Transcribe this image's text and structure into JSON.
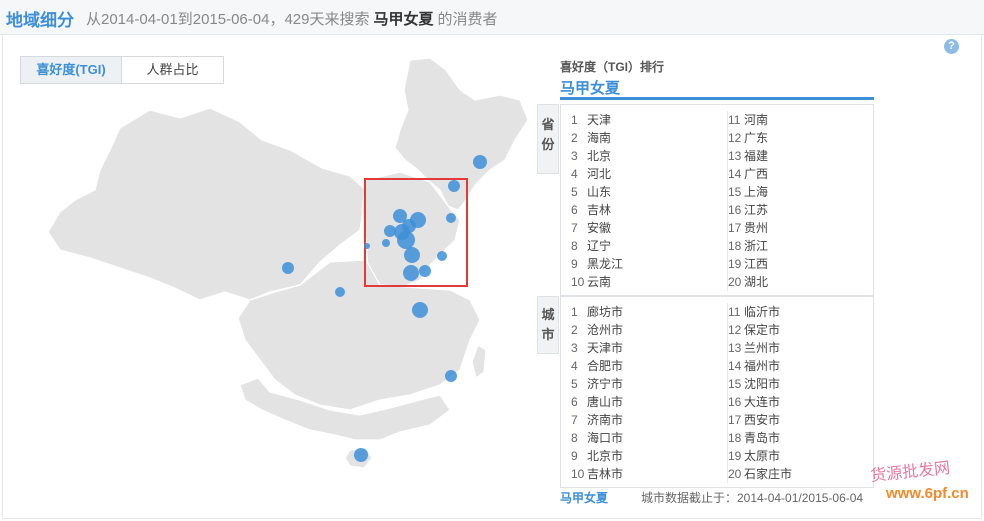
{
  "header": {
    "title": "地域细分",
    "subtitle_prefix": "从2014-04-01到2015-06-04，429天来搜索",
    "keyword": "马甲女夏",
    "subtitle_suffix": "的消费者"
  },
  "help_icon": "?",
  "toggle": {
    "tgi_label": "喜好度(TGI)",
    "share_label": "人群占比"
  },
  "ranking": {
    "title": "喜好度（TGI）排行",
    "keyword": "马甲女夏",
    "province_tab": "省份",
    "city_tab": "城市",
    "provinces_left": [
      {
        "n": "1",
        "name": "天津"
      },
      {
        "n": "2",
        "name": "海南"
      },
      {
        "n": "3",
        "name": "北京"
      },
      {
        "n": "4",
        "name": "河北"
      },
      {
        "n": "5",
        "name": "山东"
      },
      {
        "n": "6",
        "name": "吉林"
      },
      {
        "n": "7",
        "name": "安徽"
      },
      {
        "n": "8",
        "name": "辽宁"
      },
      {
        "n": "9",
        "name": "黑龙江"
      },
      {
        "n": "10",
        "name": "云南"
      }
    ],
    "provinces_right": [
      {
        "n": "11",
        "name": "河南"
      },
      {
        "n": "12",
        "name": "广东"
      },
      {
        "n": "13",
        "name": "福建"
      },
      {
        "n": "14",
        "name": "广西"
      },
      {
        "n": "15",
        "name": "上海"
      },
      {
        "n": "16",
        "name": "江苏"
      },
      {
        "n": "17",
        "name": "贵州"
      },
      {
        "n": "18",
        "name": "浙江"
      },
      {
        "n": "19",
        "name": "江西"
      },
      {
        "n": "20",
        "name": "湖北"
      }
    ],
    "cities_left": [
      {
        "n": "1",
        "name": "廊坊市"
      },
      {
        "n": "2",
        "name": "沧州市"
      },
      {
        "n": "3",
        "name": "天津市"
      },
      {
        "n": "4",
        "name": "合肥市"
      },
      {
        "n": "5",
        "name": "济宁市"
      },
      {
        "n": "6",
        "name": "唐山市"
      },
      {
        "n": "7",
        "name": "济南市"
      },
      {
        "n": "8",
        "name": "海口市"
      },
      {
        "n": "9",
        "name": "北京市"
      },
      {
        "n": "10",
        "name": "吉林市"
      }
    ],
    "cities_right": [
      {
        "n": "11",
        "name": "临沂市"
      },
      {
        "n": "12",
        "name": "保定市"
      },
      {
        "n": "13",
        "name": "兰州市"
      },
      {
        "n": "14",
        "name": "福州市"
      },
      {
        "n": "15",
        "name": "沈阳市"
      },
      {
        "n": "16",
        "name": "大连市"
      },
      {
        "n": "17",
        "name": "西安市"
      },
      {
        "n": "18",
        "name": "青岛市"
      },
      {
        "n": "19",
        "name": "太原市"
      },
      {
        "n": "20",
        "name": "石家庄市"
      }
    ]
  },
  "footer": {
    "keyword": "马甲女夏",
    "note": "城市数据截止于：2014-04-01/2015-06-04"
  },
  "watermark": {
    "line1": "货源批发网",
    "line2": "www.6pf.cn"
  },
  "colors": {
    "accent": "#3d8fd8",
    "bubble": "#3d8fd8",
    "highlight_box": "#e03a3a",
    "map_fill": "#e3e3e3"
  }
}
